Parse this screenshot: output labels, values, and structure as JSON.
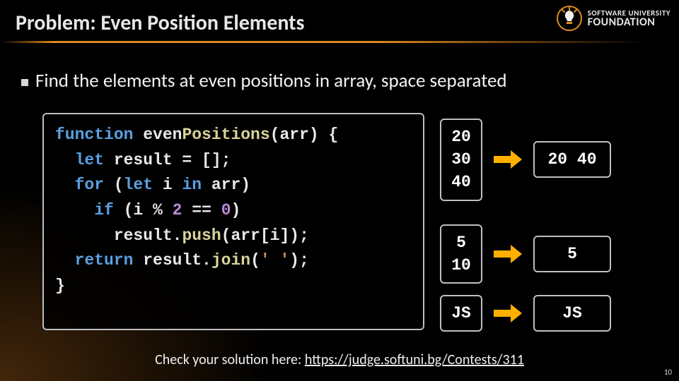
{
  "title": "Problem: Even Position Elements",
  "logo": {
    "line1": "SOFTWARE UNIVERSITY",
    "line2": "FOUNDATION"
  },
  "bullet": "Find the elements at even positions in array, space separated",
  "code": {
    "l1a": "function",
    "l1b": " even",
    "l1c": "Positions",
    "l1d": "(arr) {",
    "l2a": "  let",
    "l2b": " result = [];",
    "l3a": "  for",
    "l3b": " (",
    "l3c": "let",
    "l3d": " i ",
    "l3e": "in",
    "l3f": " arr)",
    "l4a": "    if",
    "l4b": " (i % ",
    "l4c": "2",
    "l4d": " == ",
    "l4e": "0",
    "l4f": ")",
    "l5a": "      result.",
    "l5b": "push",
    "l5c": "(arr[i]);",
    "l6a": "  return",
    "l6b": " result.",
    "l6c": "join",
    "l6d": "(",
    "l6e": "' '",
    "l6f": ");",
    "l7": "}"
  },
  "examples": [
    {
      "in": "20\n30\n40",
      "out": "20 40"
    },
    {
      "in": "5\n10",
      "out": "5"
    },
    {
      "in": "JS",
      "out": "JS"
    }
  ],
  "footer_prefix": "Check your solution here: ",
  "footer_link_text": "https://judge.softuni.bg/Contests/311",
  "footer_link_href": "https://judge.softuni.bg/Contests/311",
  "page_number": "10",
  "colors": {
    "accent": "#e08a1f"
  }
}
